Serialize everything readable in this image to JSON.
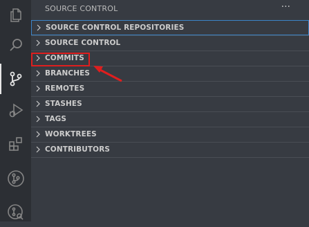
{
  "activity_bar": {
    "items": [
      {
        "icon": "files-icon"
      },
      {
        "icon": "search-icon"
      },
      {
        "icon": "source-control-icon",
        "active": true
      },
      {
        "icon": "run-debug-icon"
      },
      {
        "icon": "extensions-icon"
      },
      {
        "icon": "gitlens-icon"
      },
      {
        "icon": "gitlens-inspect-icon"
      }
    ]
  },
  "sidebar": {
    "title": "SOURCE CONTROL",
    "more_label": "···",
    "sections": [
      {
        "label": "SOURCE CONTROL REPOSITORIES",
        "focused": true
      },
      {
        "label": "SOURCE CONTROL"
      },
      {
        "label": "COMMITS",
        "highlighted": true
      },
      {
        "label": "BRANCHES"
      },
      {
        "label": "REMOTES"
      },
      {
        "label": "STASHES"
      },
      {
        "label": "TAGS"
      },
      {
        "label": "WORKTREES"
      },
      {
        "label": "CONTRIBUTORS"
      }
    ]
  },
  "annotation": {
    "color": "#e01e1e"
  }
}
